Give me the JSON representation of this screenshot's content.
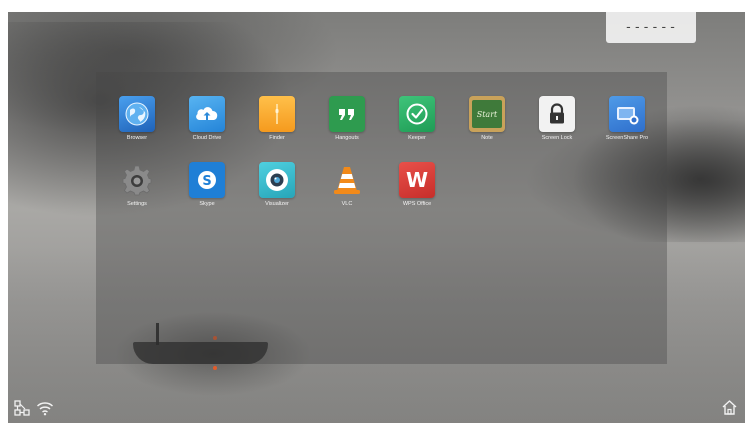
{
  "status": {
    "clock": "------"
  },
  "apps": [
    {
      "label": "Browser",
      "icon": "globe-icon",
      "color": "#2f7fd6"
    },
    {
      "label": "Cloud Drive",
      "icon": "cloud-upload-icon",
      "color": "#3a9be6"
    },
    {
      "label": "Finder",
      "icon": "folder-icon",
      "color": "#f4a62a"
    },
    {
      "label": "Hangouts",
      "icon": "quote-icon",
      "color": "#2e9b4f"
    },
    {
      "label": "Keeper",
      "icon": "checkmark-icon",
      "color": "#27ad60"
    },
    {
      "label": "Note",
      "icon": "chalkboard-icon",
      "color": "#3f7a3a",
      "icon_text": "Start"
    },
    {
      "label": "Screen Lock",
      "icon": "lock-icon",
      "color": "#f2f2f2"
    },
    {
      "label": "ScreenShare Pro",
      "icon": "screen-share-icon",
      "color": "#3a7fd0"
    },
    {
      "label": "Settings",
      "icon": "gear-icon",
      "color": "#7a7a7a"
    },
    {
      "label": "Skype",
      "icon": "skype-icon",
      "color": "#1f7fd6"
    },
    {
      "label": "Visualizer",
      "icon": "camera-icon",
      "color": "#35b6c9"
    },
    {
      "label": "VLC",
      "icon": "traffic-cone-icon",
      "color": "#f08a1c"
    },
    {
      "label": "WPS Office",
      "icon": "wps-icon",
      "color": "#d93a34",
      "icon_text": "W"
    }
  ],
  "taskbar": {
    "left_icons": [
      "network-icon",
      "wifi-icon"
    ],
    "right_icons": [
      "home-icon"
    ]
  }
}
